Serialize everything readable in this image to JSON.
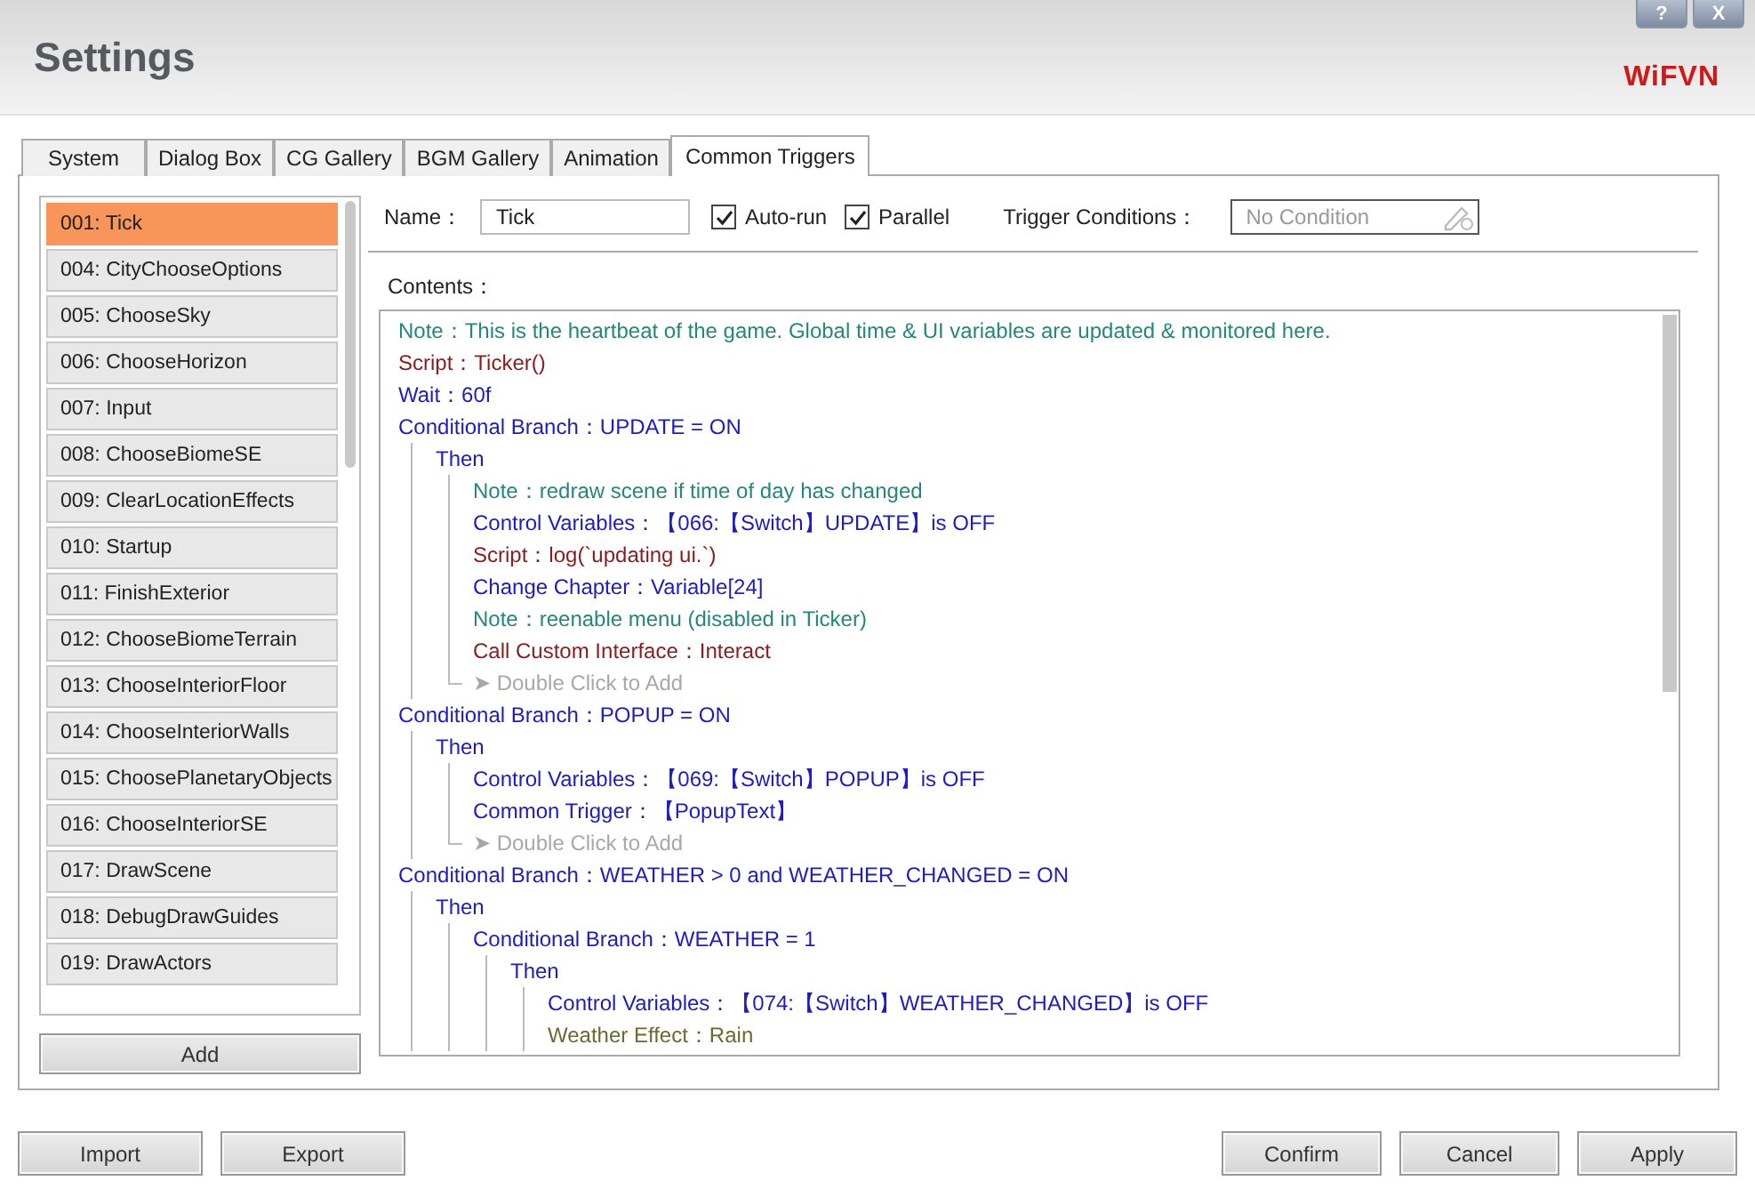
{
  "window": {
    "title": "Settings",
    "logo": "WiFVN",
    "help_button": "?",
    "close_button": "X"
  },
  "tabs": [
    {
      "label": "System",
      "selected": false
    },
    {
      "label": "Dialog Box",
      "selected": false
    },
    {
      "label": "CG Gallery",
      "selected": false
    },
    {
      "label": "BGM Gallery",
      "selected": false
    },
    {
      "label": "Animation",
      "selected": false
    },
    {
      "label": "Common Triggers",
      "selected": true
    }
  ],
  "triggers": [
    {
      "label": "001: Tick",
      "selected": true
    },
    {
      "label": "004: CityChooseOptions",
      "selected": false
    },
    {
      "label": "005: ChooseSky",
      "selected": false
    },
    {
      "label": "006: ChooseHorizon",
      "selected": false
    },
    {
      "label": "007: Input",
      "selected": false
    },
    {
      "label": "008: ChooseBiomeSE",
      "selected": false
    },
    {
      "label": "009: ClearLocationEffects",
      "selected": false
    },
    {
      "label": "010: Startup",
      "selected": false
    },
    {
      "label": "011: FinishExterior",
      "selected": false
    },
    {
      "label": "012: ChooseBiomeTerrain",
      "selected": false
    },
    {
      "label": "013: ChooseInteriorFloor",
      "selected": false
    },
    {
      "label": "014: ChooseInteriorWalls",
      "selected": false
    },
    {
      "label": "015: ChoosePlanetaryObjects",
      "selected": false
    },
    {
      "label": "016: ChooseInteriorSE",
      "selected": false
    },
    {
      "label": "017: DrawScene",
      "selected": false
    },
    {
      "label": "018: DebugDrawGuides",
      "selected": false
    },
    {
      "label": "019: DrawActors",
      "selected": false
    }
  ],
  "add_button": "Add",
  "name_label": "Name：",
  "name_value": "Tick",
  "options": [
    {
      "label": "Auto-run",
      "checked": true
    },
    {
      "label": "Parallel",
      "checked": true
    }
  ],
  "conditions_label": "Trigger Conditions：",
  "conditions_placeholder": "No Condition",
  "contents_label": "Contents：",
  "contents": [
    {
      "kind": "note",
      "text": "Note：This is the heartbeat of the game. Global time & UI variables are updated & monitored here."
    },
    {
      "kind": "script",
      "text": "Script：Ticker()"
    },
    {
      "kind": "command",
      "text": "Wait：60f"
    },
    {
      "kind": "command",
      "text": "Conditional Branch：UPDATE = ON",
      "children": [
        {
          "kind": "command",
          "text": "Then",
          "children": [
            {
              "kind": "note",
              "text": "Note：redraw scene if time of day has changed"
            },
            {
              "kind": "command",
              "text": "Control Variables：【066:【Switch】UPDATE】is OFF"
            },
            {
              "kind": "script",
              "text": "Script：log(`updating ui.`)"
            },
            {
              "kind": "command",
              "text": "Change Chapter：Variable[24]"
            },
            {
              "kind": "note",
              "text": "Note：reenable menu (disabled in Ticker)"
            },
            {
              "kind": "script",
              "text": "Call Custom Interface：Interact"
            },
            {
              "kind": "add",
              "text": "➤ Double Click to Add"
            }
          ]
        }
      ]
    },
    {
      "kind": "command",
      "text": "Conditional Branch：POPUP = ON",
      "children": [
        {
          "kind": "command",
          "text": "Then",
          "children": [
            {
              "kind": "command",
              "text": "Control Variables：【069:【Switch】POPUP】is OFF"
            },
            {
              "kind": "command",
              "text": "Common Trigger：【PopupText】"
            },
            {
              "kind": "add",
              "text": "➤ Double Click to Add"
            }
          ]
        }
      ]
    },
    {
      "kind": "command",
      "text": "Conditional Branch：WEATHER > 0 and WEATHER_CHANGED = ON",
      "children": [
        {
          "kind": "command",
          "text": "Then",
          "children": [
            {
              "kind": "command",
              "text": "Conditional Branch：WEATHER = 1",
              "children": [
                {
                  "kind": "command",
                  "text": "Then",
                  "children": [
                    {
                      "kind": "command",
                      "text": "Control Variables：【074:【Switch】WEATHER_CHANGED】is OFF"
                    },
                    {
                      "kind": "effect",
                      "text": "Weather Effect：Rain"
                    }
                  ]
                }
              ]
            }
          ]
        }
      ]
    }
  ],
  "footer_left": [
    "Import",
    "Export"
  ],
  "footer_right": [
    "Confirm",
    "Cancel",
    "Apply"
  ]
}
